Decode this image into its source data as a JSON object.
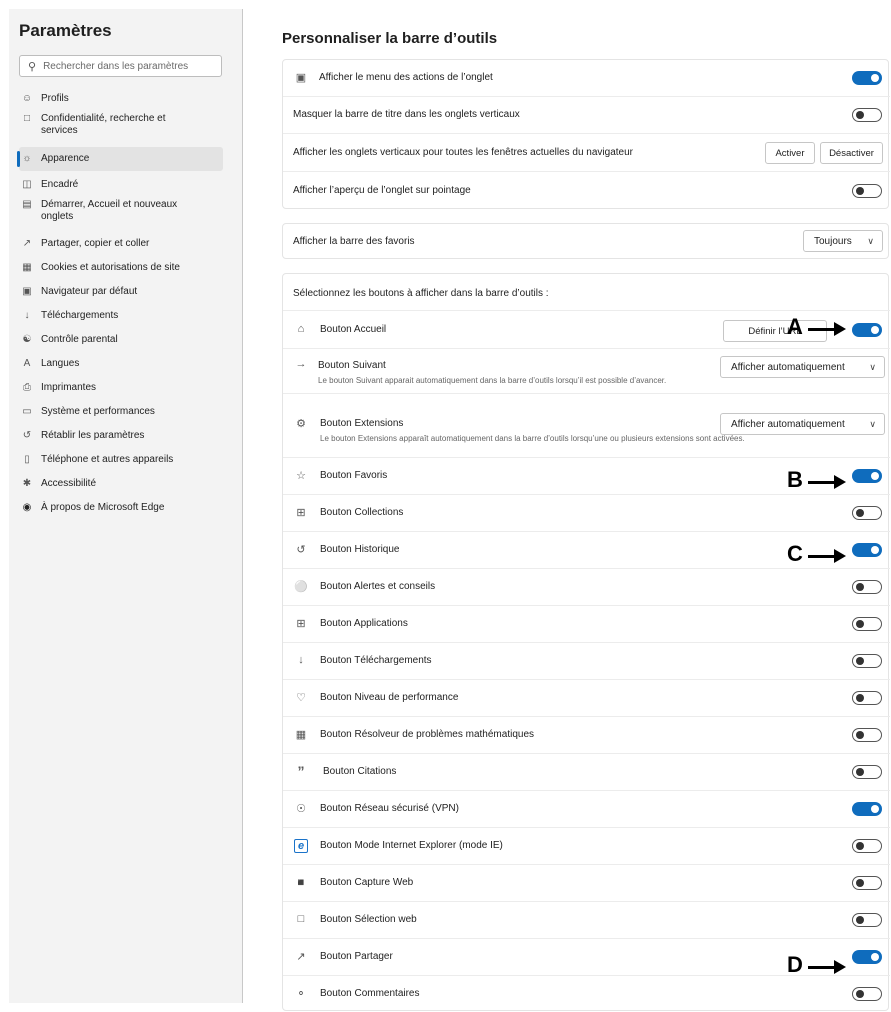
{
  "sidebar": {
    "title": "Paramètres",
    "search_placeholder": "Rechercher dans les paramètres",
    "items": [
      {
        "label": "Profils",
        "icon": "profile-icon"
      },
      {
        "label": "Confidentialité, recherche et services",
        "icon": "lock-icon"
      },
      {
        "label": "Apparence",
        "icon": "appearance-icon"
      },
      {
        "label": "Encadré",
        "icon": "sidebar-icon"
      },
      {
        "label": "Démarrer, Accueil et nouveaux onglets",
        "icon": "home-tab-icon"
      },
      {
        "label": "Partager, copier et coller",
        "icon": "share-icon"
      },
      {
        "label": "Cookies et autorisations de site",
        "icon": "cookie-icon"
      },
      {
        "label": "Navigateur par défaut",
        "icon": "browser-icon"
      },
      {
        "label": "Téléchargements",
        "icon": "download-icon"
      },
      {
        "label": "Contrôle parental",
        "icon": "family-icon"
      },
      {
        "label": "Langues",
        "icon": "language-icon"
      },
      {
        "label": "Imprimantes",
        "icon": "printer-icon"
      },
      {
        "label": "Système et performances",
        "icon": "system-icon"
      },
      {
        "label": "Rétablir les paramètres",
        "icon": "reset-icon"
      },
      {
        "label": "Téléphone et autres appareils",
        "icon": "phone-icon"
      },
      {
        "label": "Accessibilité",
        "icon": "accessibility-icon"
      },
      {
        "label": "À propos de Microsoft Edge",
        "icon": "edge-icon"
      }
    ],
    "active_index": 2
  },
  "main": {
    "title": "Personnaliser la barre d’outils",
    "section1": {
      "rows": [
        {
          "label": "Afficher le menu des actions de l’onglet",
          "toggle": true,
          "icon": "tab-actions-icon"
        },
        {
          "label": "Masquer la barre de titre dans les onglets verticaux",
          "toggle": false
        },
        {
          "label": "Afficher les onglets verticaux pour toutes les fenêtres actuelles du navigateur",
          "btn_activate": "Activer",
          "btn_deactivate": "Désactiver"
        },
        {
          "label": "Afficher l’aperçu de l’onglet sur pointage",
          "toggle": false
        }
      ]
    },
    "section2": {
      "label": "Afficher la barre des favoris",
      "select_value": "Toujours"
    },
    "section3": {
      "header": "Sélectionnez les boutons à afficher dans la barre d’outils :",
      "home": {
        "label": "Bouton Accueil",
        "button": "Définir l’URL",
        "toggle": true
      },
      "next": {
        "label": "Bouton Suivant",
        "select_value": "Afficher automatiquement",
        "sub": "Le bouton Suivant apparait automatiquement dans la barre d’outils lorsqu’il est possible d’avancer."
      },
      "extensions": {
        "label": "Bouton Extensions",
        "select_value": "Afficher automatiquement",
        "sub": "Le bouton Extensions apparaît automatiquement dans la barre d’outils lorsqu’une ou plusieurs extensions sont activées."
      },
      "toggles": [
        {
          "label": "Bouton Favoris",
          "on": true,
          "icon": "favorites-icon"
        },
        {
          "label": "Bouton Collections",
          "on": false,
          "icon": "collections-icon"
        },
        {
          "label": "Bouton Historique",
          "on": true,
          "icon": "history-icon"
        },
        {
          "label": "Bouton Alertes et conseils",
          "on": false,
          "icon": "bell-icon"
        },
        {
          "label": "Bouton Applications",
          "on": false,
          "icon": "apps-icon"
        },
        {
          "label": "Bouton Téléchargements",
          "on": false,
          "icon": "download-icon"
        },
        {
          "label": "Bouton Niveau de performance",
          "on": false,
          "icon": "performance-icon"
        },
        {
          "label": "Bouton Résolveur de problèmes mathématiques",
          "on": false,
          "icon": "math-icon"
        },
        {
          "label": "Bouton Citations",
          "on": false,
          "icon": "quote-icon"
        },
        {
          "label": "Bouton Réseau sécurisé (VPN)",
          "on": true,
          "icon": "vpn-shield-icon"
        },
        {
          "label": "Bouton Mode Internet Explorer (mode IE)",
          "on": false,
          "icon": "ie-icon"
        },
        {
          "label": "Bouton Capture Web",
          "on": false,
          "icon": "web-capture-icon"
        },
        {
          "label": "Bouton Sélection web",
          "on": false,
          "icon": "web-select-icon"
        },
        {
          "label": "Bouton Partager",
          "on": true,
          "icon": "share-icon"
        },
        {
          "label": "Bouton Commentaires",
          "on": false,
          "icon": "feedback-icon"
        }
      ]
    }
  },
  "annotations": {
    "a": "A",
    "b": "B",
    "c": "C",
    "d": "D"
  },
  "colors": {
    "accent": "#0f6cbd",
    "sidebar_bg": "#f3f3f3"
  }
}
